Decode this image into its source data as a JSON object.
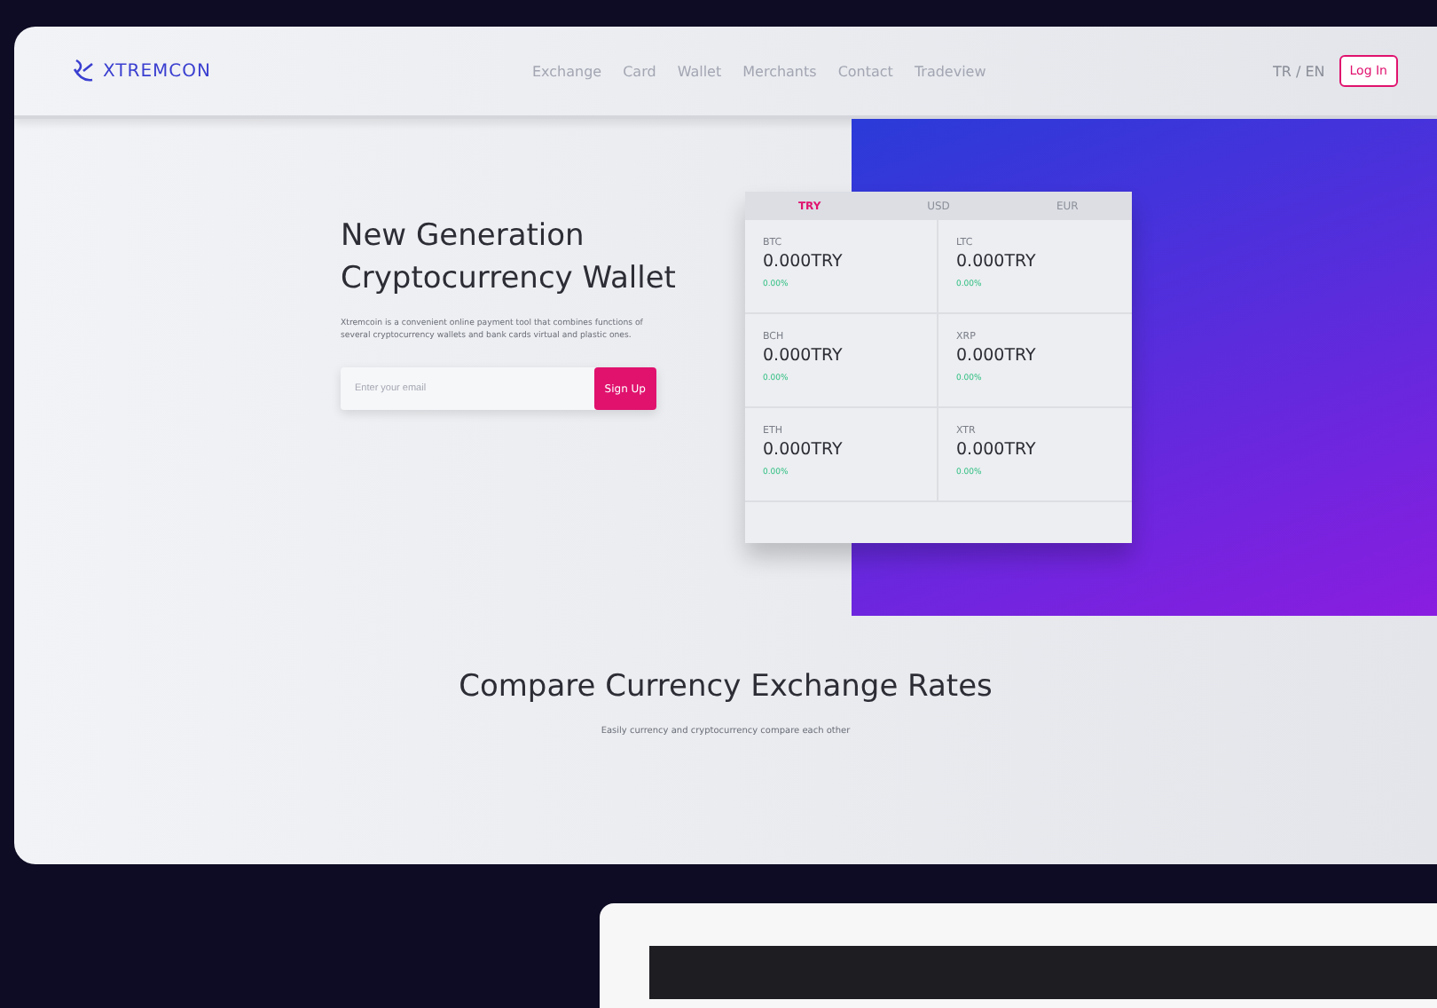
{
  "header": {
    "logo": "XTREMCON",
    "nav": [
      {
        "label": "Exchange"
      },
      {
        "label": "Card"
      },
      {
        "label": "Wallet"
      },
      {
        "label": "Merchants"
      },
      {
        "label": "Contact"
      },
      {
        "label": "Tradeview"
      }
    ],
    "language": "TR / EN",
    "login": "Log In"
  },
  "hero": {
    "title": "New Generation Cryptocurrency Wallet",
    "description": "Xtremcoin is a convenient online payment tool that combines functions of several cryptocurrency wallets and bank cards virtual and plastic ones.",
    "email": {
      "placeholder": "Enter your email"
    },
    "signup": "Sign Up"
  },
  "rates": {
    "tabs": [
      {
        "label": "TRY",
        "selected": true
      },
      {
        "label": "USD",
        "selected": false
      },
      {
        "label": "EUR",
        "selected": false
      }
    ],
    "coins": [
      {
        "symbol": "BTC",
        "price": "0.000TRY",
        "change": "0.00%"
      },
      {
        "symbol": "LTC",
        "price": "0.000TRY",
        "change": "0.00%"
      },
      {
        "symbol": "BCH",
        "price": "0.000TRY",
        "change": "0.00%"
      },
      {
        "symbol": "XRP",
        "price": "0.000TRY",
        "change": "0.00%"
      },
      {
        "symbol": "ETH",
        "price": "0.000TRY",
        "change": "0.00%"
      },
      {
        "symbol": "XTR",
        "price": "0.000TRY",
        "change": "0.00%"
      }
    ]
  },
  "compare": {
    "title": "Compare Currency Exchange Rates",
    "subtitle": "Easily currency and cryptocurrency compare each other"
  }
}
